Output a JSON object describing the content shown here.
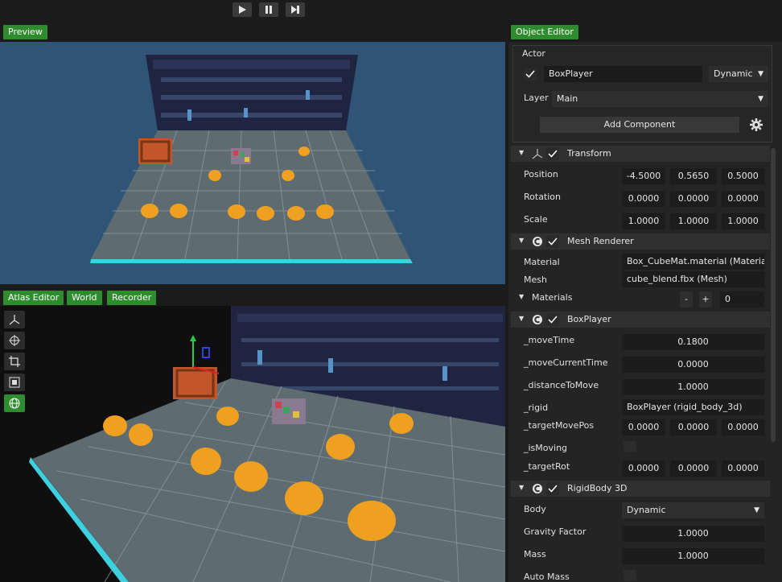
{
  "toolbar": {
    "play": "play-icon",
    "pause": "pause-icon",
    "step": "step-icon"
  },
  "tabs": {
    "preview": "Preview",
    "atlas_editor": "Atlas Editor",
    "world": "World",
    "recorder": "Recorder",
    "object_editor": "Object Editor"
  },
  "actor": {
    "heading": "Actor",
    "name": "BoxPlayer",
    "body_type": "Dynamic",
    "layer_label": "Layer",
    "layer": "Main",
    "add_component": "Add Component"
  },
  "transform": {
    "title": "Transform",
    "rows": [
      {
        "label": "Position",
        "values": [
          "-4.5000",
          "0.5650",
          "0.5000"
        ]
      },
      {
        "label": "Rotation",
        "values": [
          "0.0000",
          "0.0000",
          "0.0000"
        ]
      },
      {
        "label": "Scale",
        "values": [
          "1.0000",
          "1.0000",
          "1.0000"
        ]
      }
    ]
  },
  "mesh_renderer": {
    "title": "Mesh Renderer",
    "material_label": "Material",
    "material": "Box_CubeMat.material (Material)",
    "mesh_label": "Mesh",
    "mesh": "cube_blend.fbx (Mesh)",
    "materials_label": "Materials",
    "minus": "-",
    "plus": "+",
    "count": "0"
  },
  "box_player": {
    "title": "BoxPlayer",
    "move_time_label": "_moveTime",
    "move_time": "0.1800",
    "move_current_time_label": "_moveCurrentTime",
    "move_current_time": "0.0000",
    "distance_label": "_distanceToMove",
    "distance": "1.0000",
    "rigid_label": "_rigid",
    "rigid": "BoxPlayer (rigid_body_3d)",
    "target_move_pos_label": "_targetMovePos",
    "target_move_pos": [
      "0.0000",
      "0.0000",
      "0.0000"
    ],
    "is_moving_label": "_isMoving",
    "target_rot_label": "_targetRot",
    "target_rot": [
      "0.0000",
      "0.0000",
      "0.0000"
    ]
  },
  "rigid_body": {
    "title": "RigidBody 3D",
    "body_label": "Body",
    "body": "Dynamic",
    "gravity_label": "Gravity Factor",
    "gravity": "1.0000",
    "mass_label": "Mass",
    "mass": "1.0000",
    "auto_mass_label": "Auto Mass"
  },
  "colors": {
    "accent_green": "#2e8b2e",
    "preview_bg": "#2f5476",
    "panel_bg": "#242424"
  }
}
